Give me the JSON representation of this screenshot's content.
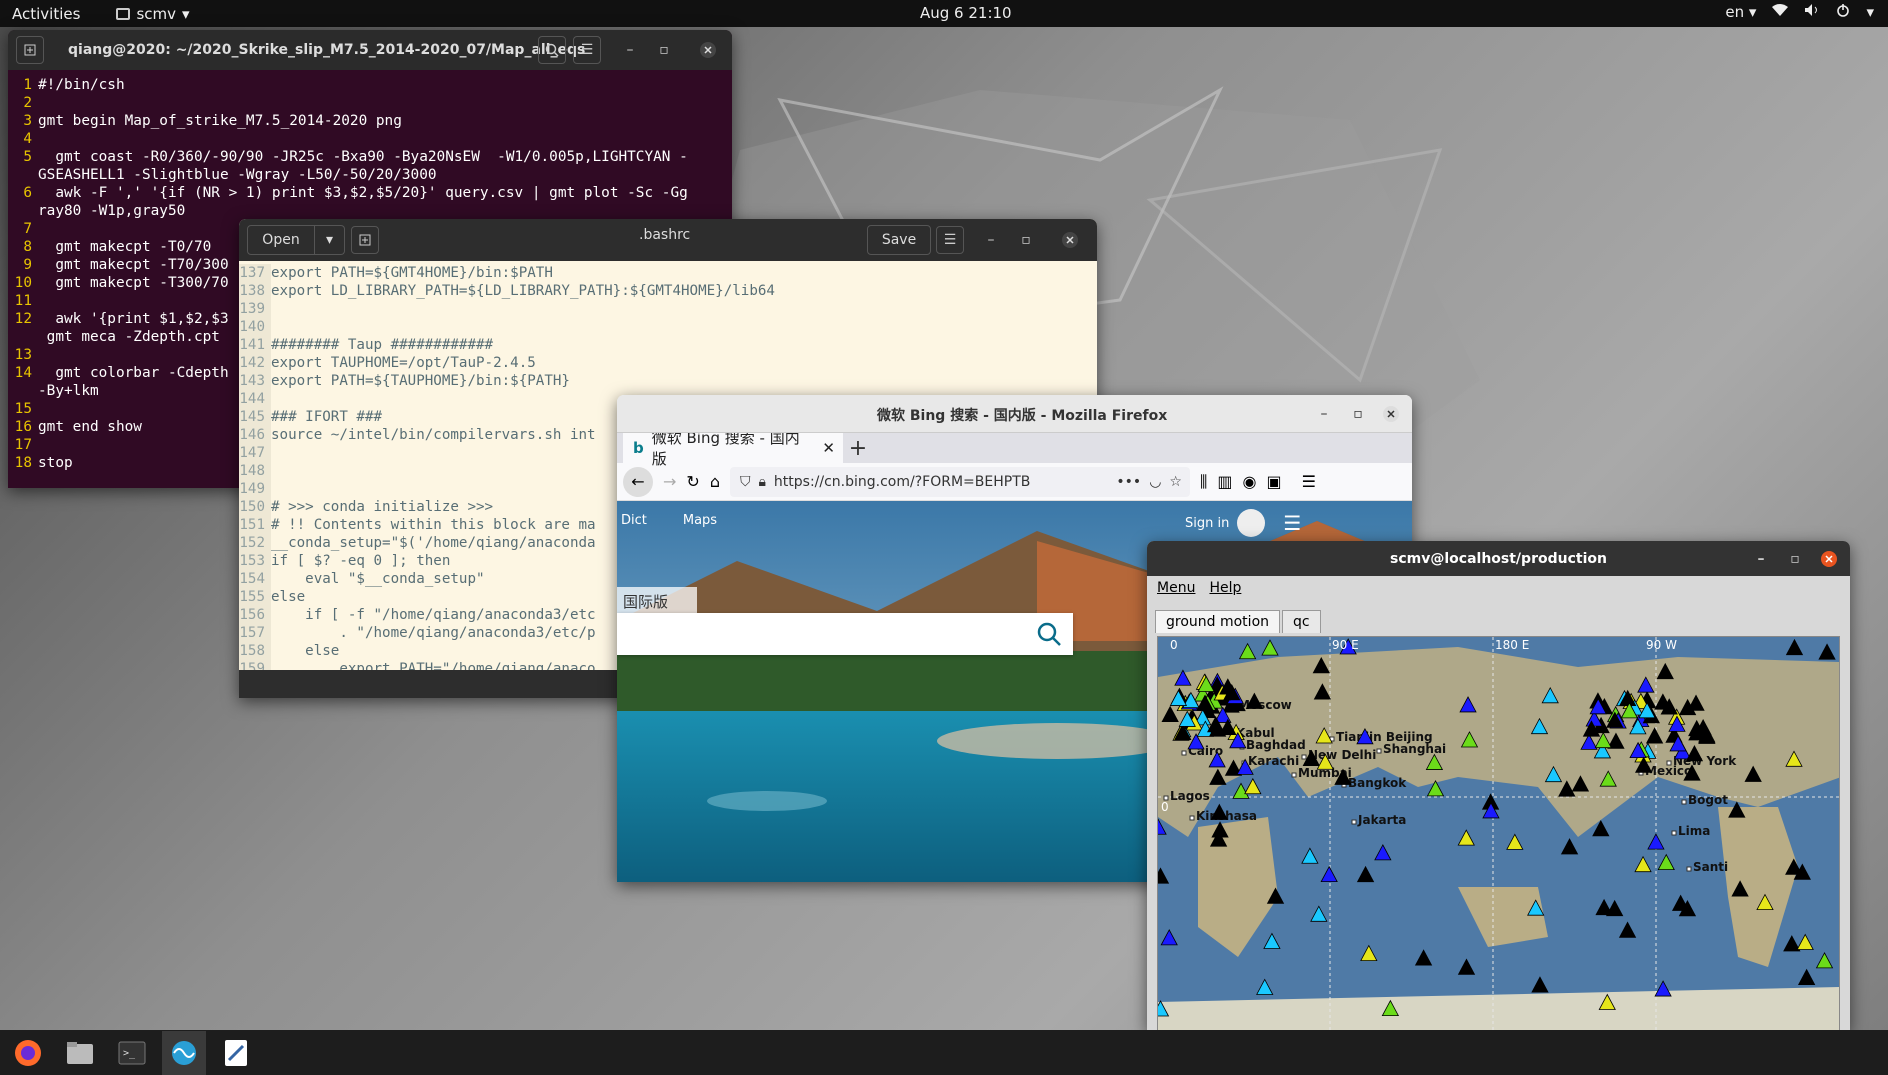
{
  "topbar": {
    "activities": "Activities",
    "app": "scmv",
    "clock": "Aug 6  21:10",
    "lang": "en"
  },
  "terminal": {
    "title": "qiang@2020: ~/2020_Skrike_slip_M7.5_2014-2020_07/Map_all_eqs",
    "lines": [
      {
        "n": "1",
        "t": "#!/bin/csh"
      },
      {
        "n": "2",
        "t": ""
      },
      {
        "n": "3",
        "t": "gmt begin Map_of_strike_M7.5_2014-2020 png"
      },
      {
        "n": "4",
        "t": ""
      },
      {
        "n": "5",
        "t": "  gmt coast -R0/360/-90/90 -JR25c -Bxa90 -Bya20NsEW  -W1/0.005p,LIGHTCYAN -"
      },
      {
        "n": "",
        "t": "GSEASHELL1 -Slightblue -Wgray -L50/-50/20/3000"
      },
      {
        "n": "6",
        "t": "  awk -F ',' '{if (NR > 1) print $3,$2,$5/20}' query.csv | gmt plot -Sc -Gg"
      },
      {
        "n": "",
        "t": "ray80 -W1p,gray50"
      },
      {
        "n": "7",
        "t": ""
      },
      {
        "n": "8",
        "t": "  gmt makecpt -T0/70"
      },
      {
        "n": "9",
        "t": "  gmt makecpt -T70/300"
      },
      {
        "n": "10",
        "t": "  gmt makecpt -T300/70"
      },
      {
        "n": "11",
        "t": ""
      },
      {
        "n": "12",
        "t": "  awk '{print $1,$2,$3"
      },
      {
        "n": "",
        "t": " gmt meca -Zdepth.cpt"
      },
      {
        "n": "13",
        "t": ""
      },
      {
        "n": "14",
        "t": "  gmt colorbar -Cdepth"
      },
      {
        "n": "",
        "t": "-By+lkm"
      },
      {
        "n": "15",
        "t": ""
      },
      {
        "n": "16",
        "t": "gmt end show"
      },
      {
        "n": "17",
        "t": ""
      },
      {
        "n": "18",
        "t": "stop"
      }
    ]
  },
  "gedit": {
    "open": "Open",
    "title": ".bashrc",
    "save": "Save",
    "lines": [
      {
        "n": "137",
        "t": "export PATH=${GMT4HOME}/bin:$PATH"
      },
      {
        "n": "138",
        "t": "export LD_LIBRARY_PATH=${LD_LIBRARY_PATH}:${GMT4HOME}/lib64"
      },
      {
        "n": "139",
        "t": ""
      },
      {
        "n": "140",
        "t": ""
      },
      {
        "n": "141",
        "t": "######## Taup ############"
      },
      {
        "n": "142",
        "t": "export TAUPHOME=/opt/TauP-2.4.5"
      },
      {
        "n": "143",
        "t": "export PATH=${TAUPHOME}/bin:${PATH}"
      },
      {
        "n": "144",
        "t": ""
      },
      {
        "n": "145",
        "t": "### IFORT ###"
      },
      {
        "n": "146",
        "t": "source ~/intel/bin/compilervars.sh int"
      },
      {
        "n": "147",
        "t": ""
      },
      {
        "n": "148",
        "t": ""
      },
      {
        "n": "149",
        "t": ""
      },
      {
        "n": "150",
        "t": "# >>> conda initialize >>>"
      },
      {
        "n": "151",
        "t": "# !! Contents within this block are ma"
      },
      {
        "n": "152",
        "t": "__conda_setup=\"$('/home/qiang/anaconda"
      },
      {
        "n": "153",
        "t": "if [ $? -eq 0 ]; then"
      },
      {
        "n": "154",
        "t": "    eval \"$__conda_setup\""
      },
      {
        "n": "155",
        "t": "else"
      },
      {
        "n": "156",
        "t": "    if [ -f \"/home/qiang/anaconda3/etc"
      },
      {
        "n": "157",
        "t": "        . \"/home/qiang/anaconda3/etc/p"
      },
      {
        "n": "158",
        "t": "    else"
      },
      {
        "n": "159",
        "t": "        export PATH=\"/home/qiang/anaco"
      }
    ]
  },
  "firefox": {
    "title": "微软 Bing 搜索 - 国内版 - Mozilla Firefox",
    "tab": "微软 Bing 搜索 - 国内版",
    "url": "https://cn.bing.com/?FORM=BEHPTB",
    "dict": "Dict",
    "maps": "Maps",
    "signin": "Sign in",
    "intl": "国际版"
  },
  "scmv": {
    "title": "scmv@localhost/production",
    "menu": "Menu",
    "help": "Help",
    "tab1": "ground motion",
    "tab2": "qc",
    "labels": {
      "lon0": "0",
      "lon90e": "90 E",
      "lon180e": "180 E",
      "lon90w": "90 W",
      "lat0": "0"
    },
    "cities": [
      "Moscow",
      "Kabul",
      "Cairo",
      "Baghdad",
      "Karachi",
      "New Delhi",
      "Mumbai",
      "Tianjin Beijing",
      "Shanghai",
      "Bangkok",
      "Lagos",
      "Kinshasa",
      "Jakarta",
      "New York",
      "Mexico",
      "Bogot",
      "Lima",
      "Santi"
    ]
  }
}
